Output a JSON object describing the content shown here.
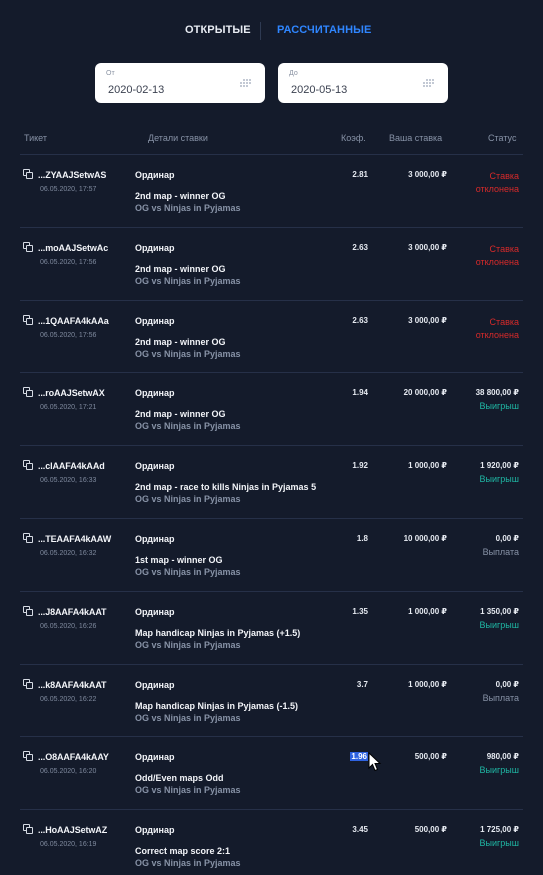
{
  "tabs": {
    "open": "ОТКРЫТЫЕ",
    "settled": "РАССЧИТАННЫЕ",
    "active": "settled"
  },
  "filters": {
    "from_label": "От",
    "from_value": "2020-02-13",
    "to_label": "До",
    "to_value": "2020-05-13"
  },
  "columns": {
    "ticket": "Тикет",
    "details": "Детали ставки",
    "coef": "Коэф.",
    "stake": "Ваша ставка",
    "status": "Статус"
  },
  "colors": {
    "accent": "#2f86ff",
    "rejected": "#d62a2a",
    "win": "#1fb7a4",
    "background": "#141b2b"
  },
  "bets": [
    {
      "id": "...ZYAAJSetwAS",
      "date": "06.05.2020, 17:57",
      "type": "Ординар",
      "market": "2nd map - winner OG",
      "event": "OG vs Ninjas in Pyjamas",
      "coef": "2.81",
      "stake": "3 000,00 ₽",
      "payout": "",
      "status": "Ставка отклонена",
      "status_kind": "rejected"
    },
    {
      "id": "...moAAJSetwAc",
      "date": "06.05.2020, 17:56",
      "type": "Ординар",
      "market": "2nd map - winner OG",
      "event": "OG vs Ninjas in Pyjamas",
      "coef": "2.63",
      "stake": "3 000,00 ₽",
      "payout": "",
      "status": "Ставка отклонена",
      "status_kind": "rejected"
    },
    {
      "id": "...1QAAFA4kAAa",
      "date": "06.05.2020, 17:56",
      "type": "Ординар",
      "market": "2nd map - winner OG",
      "event": "OG vs Ninjas in Pyjamas",
      "coef": "2.63",
      "stake": "3 000,00 ₽",
      "payout": "",
      "status": "Ставка отклонена",
      "status_kind": "rejected"
    },
    {
      "id": "...roAAJSetwAX",
      "date": "06.05.2020, 17:21",
      "type": "Ординар",
      "market": "2nd map - winner OG",
      "event": "OG vs Ninjas in Pyjamas",
      "coef": "1.94",
      "stake": "20 000,00 ₽",
      "payout": "38 800,00 ₽",
      "status": "Выигрыш",
      "status_kind": "win"
    },
    {
      "id": "...clAAFA4kAAd",
      "date": "06.05.2020, 16:33",
      "type": "Ординар",
      "market": "2nd map - race to kills Ninjas in Pyjamas 5",
      "event": "OG vs Ninjas in Pyjamas",
      "coef": "1.92",
      "stake": "1 000,00 ₽",
      "payout": "1 920,00 ₽",
      "status": "Выигрыш",
      "status_kind": "win"
    },
    {
      "id": "...TEAAFA4kAAW",
      "date": "06.05.2020, 16:32",
      "type": "Ординар",
      "market": "1st map - winner OG",
      "event": "OG vs Ninjas in Pyjamas",
      "coef": "1.8",
      "stake": "10 000,00 ₽",
      "payout": "0,00 ₽",
      "status": "Выплата",
      "status_kind": "payout"
    },
    {
      "id": "...J8AAFA4kAAT",
      "date": "06.05.2020, 16:26",
      "type": "Ординар",
      "market": "Map handicap Ninjas in Pyjamas (+1.5)",
      "event": "OG vs Ninjas in Pyjamas",
      "coef": "1.35",
      "stake": "1 000,00 ₽",
      "payout": "1 350,00 ₽",
      "status": "Выигрыш",
      "status_kind": "win"
    },
    {
      "id": "...k8AAFA4kAAT",
      "date": "06.05.2020, 16:22",
      "type": "Ординар",
      "market": "Map handicap Ninjas in Pyjamas (-1.5)",
      "event": "OG vs Ninjas in Pyjamas",
      "coef": "3.7",
      "stake": "1 000,00 ₽",
      "payout": "0,00 ₽",
      "status": "Выплата",
      "status_kind": "payout"
    },
    {
      "id": "...O8AAFA4kAAY",
      "date": "06.05.2020, 16:20",
      "type": "Ординар",
      "market": "Odd/Even maps Odd",
      "event": "OG vs Ninjas in Pyjamas",
      "coef": "1.96",
      "stake": "500,00 ₽",
      "payout": "980,00 ₽",
      "status": "Выигрыш",
      "status_kind": "win",
      "selected": true
    },
    {
      "id": "...HoAAJSetwAZ",
      "date": "06.05.2020, 16:19",
      "type": "Ординар",
      "market": "Correct map score 2:1",
      "event": "OG vs Ninjas in Pyjamas",
      "coef": "3.45",
      "stake": "500,00 ₽",
      "payout": "1 725,00 ₽",
      "status": "Выигрыш",
      "status_kind": "win"
    }
  ]
}
